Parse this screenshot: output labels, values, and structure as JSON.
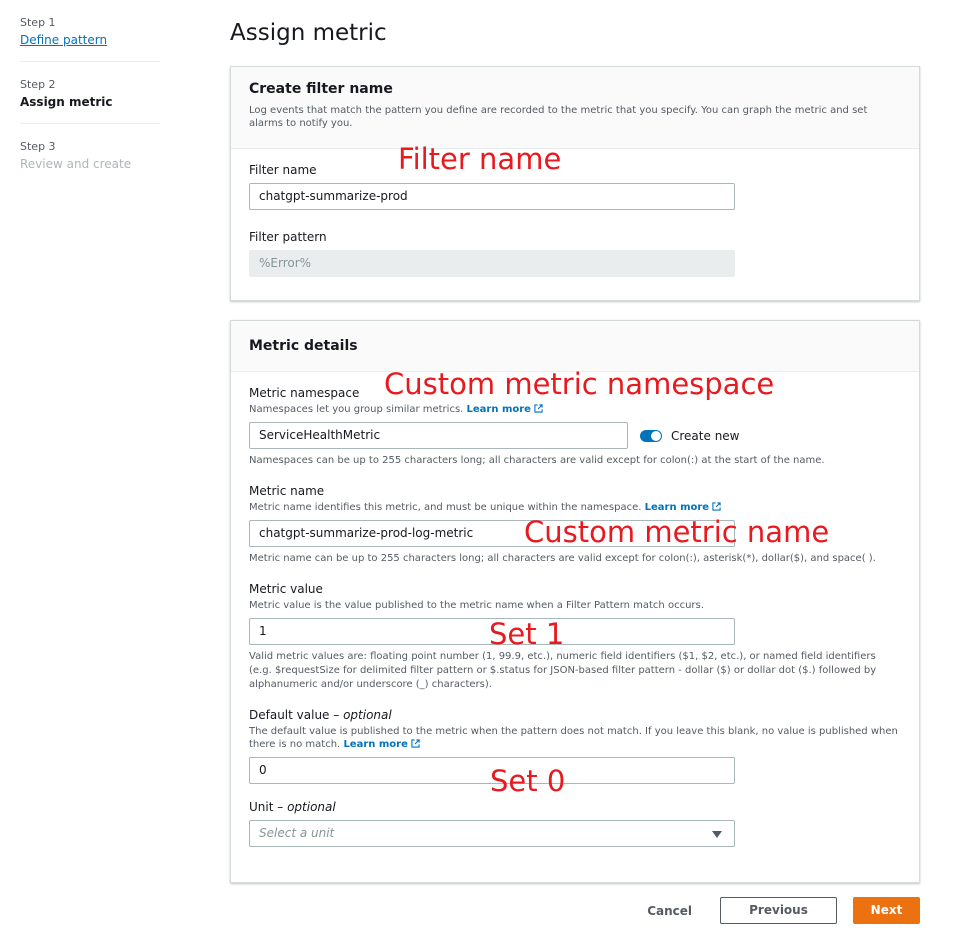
{
  "steps": [
    {
      "number": "Step 1",
      "title": "Define pattern"
    },
    {
      "number": "Step 2",
      "title": "Assign metric"
    },
    {
      "number": "Step 3",
      "title": "Review and create"
    }
  ],
  "page_title": "Assign metric",
  "filter_section": {
    "title": "Create filter name",
    "description": "Log events that match the pattern you define are recorded to the metric that you specify. You can graph the metric and set alarms to notify you.",
    "filter_name_label": "Filter name",
    "filter_name_value": "chatgpt-summarize-prod",
    "filter_pattern_label": "Filter pattern",
    "filter_pattern_value": "%Error%"
  },
  "metric_section": {
    "title": "Metric details",
    "namespace_label": "Metric namespace",
    "namespace_desc": "Namespaces let you group similar metrics.",
    "namespace_value": "ServiceHealthMetric",
    "create_new_label": "Create new",
    "namespace_constraint": "Namespaces can be up to 255 characters long; all characters are valid except for colon(:) at the start of the name.",
    "name_label": "Metric name",
    "name_desc": "Metric name identifies this metric, and must be unique within the namespace.",
    "name_value": "chatgpt-summarize-prod-log-metric",
    "name_constraint": "Metric name can be up to 255 characters long; all characters are valid except for colon(:), asterisk(*), dollar($), and space( ).",
    "value_label": "Metric value",
    "value_desc": "Metric value is the value published to the metric name when a Filter Pattern match occurs.",
    "value_value": "1",
    "value_constraint": "Valid metric values are: floating point number (1, 99.9, etc.), numeric field identifiers ($1, $2, etc.), or named field identifiers (e.g. $requestSize for delimited filter pattern or $.status for JSON-based filter pattern - dollar ($) or dollar dot ($.) followed by alphanumeric and/or underscore (_) characters).",
    "default_label": "Default value",
    "default_optional": "optional",
    "default_desc": "The default value is published to the metric when the pattern does not match. If you leave this blank, no value is published when there is no match.",
    "default_value": "0",
    "unit_label": "Unit",
    "unit_optional": "optional",
    "unit_placeholder": "Select a unit",
    "learn_more": "Learn more"
  },
  "annotations": {
    "filter_name": "Filter name",
    "namespace": "Custom metric namespace",
    "metric_name": "Custom metric name",
    "set1": "Set 1",
    "set0": "Set 0"
  },
  "footer": {
    "cancel": "Cancel",
    "previous": "Previous",
    "next": "Next"
  },
  "colors": {
    "accent": "#0073bb",
    "primary_button": "#ec7211",
    "annotation": "#e8191f"
  }
}
